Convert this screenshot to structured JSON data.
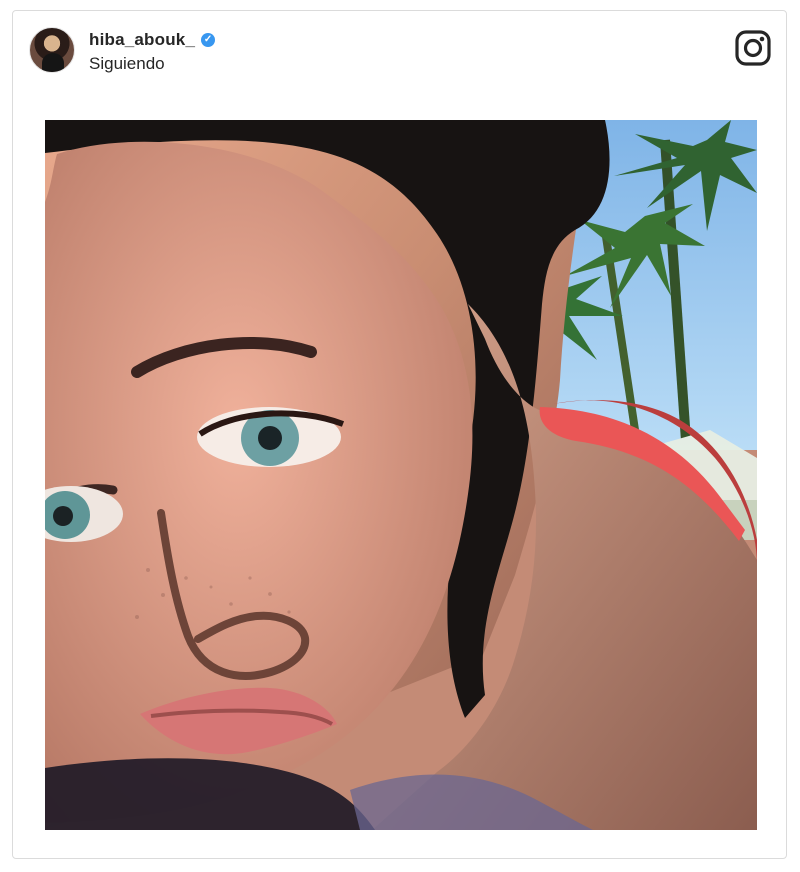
{
  "post": {
    "username": "hiba_abouk_",
    "follow_status": "Siguiendo",
    "verified": true,
    "icons": {
      "avatar": "profile-avatar",
      "verified": "verified-badge-icon",
      "brand": "instagram-icon"
    },
    "colors": {
      "border": "#dbdbdb",
      "verified": "#3897f0",
      "text": "#262626"
    }
  }
}
